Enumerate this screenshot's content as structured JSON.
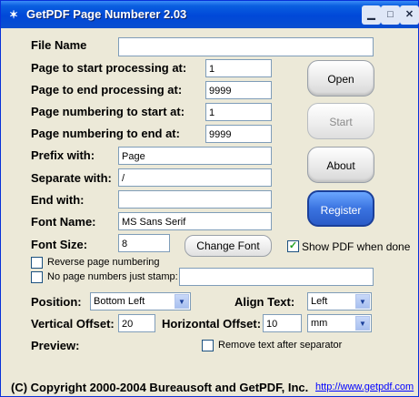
{
  "window": {
    "title": "GetPDF Page Numberer 2.03",
    "minimize": "▁",
    "maximize": "□",
    "close": "✕"
  },
  "fields": {
    "file_name": {
      "label": "File Name",
      "value": ""
    },
    "start_processing": {
      "label": "Page to start processing at:",
      "value": "1"
    },
    "end_processing": {
      "label": "Page to end processing at:",
      "value": "9999"
    },
    "numbering_start": {
      "label": "Page numbering to start at:",
      "value": "1"
    },
    "numbering_end": {
      "label": "Page numbering to end at:",
      "value": "9999"
    },
    "prefix": {
      "label": "Prefix with:",
      "value": "Page"
    },
    "separate": {
      "label": "Separate with:",
      "value": "/"
    },
    "end_with": {
      "label": "End with:",
      "value": ""
    },
    "font_name": {
      "label": "Font Name:",
      "value": "MS Sans Serif"
    },
    "font_size": {
      "label": "Font Size:",
      "value": "8"
    }
  },
  "buttons": {
    "open": "Open",
    "start": "Start",
    "about": "About",
    "register": "Register",
    "change_font": "Change Font"
  },
  "checks": {
    "show_pdf": {
      "label": "Show PDF when done",
      "checked": true
    },
    "reverse": {
      "label": "Reverse page numbering",
      "checked": false
    },
    "stamp": {
      "label": "No page numbers just stamp:",
      "checked": false,
      "value": ""
    },
    "remove_text": {
      "label": "Remove text after separator",
      "checked": false
    }
  },
  "position": {
    "label": "Position:",
    "value": "Bottom Left"
  },
  "align": {
    "label": "Align Text:",
    "value": "Left"
  },
  "vertical_offset": {
    "label": "Vertical Offset:",
    "value": "20"
  },
  "horizontal_offset": {
    "label": "Horizontal Offset:",
    "value": "10"
  },
  "units": {
    "value": "mm"
  },
  "preview": {
    "label": "Preview:"
  },
  "footer": {
    "copyright": "(C) Copyright 2000-2004 Bureausoft and GetPDF, Inc.",
    "link": "http://www.getpdf.com"
  }
}
